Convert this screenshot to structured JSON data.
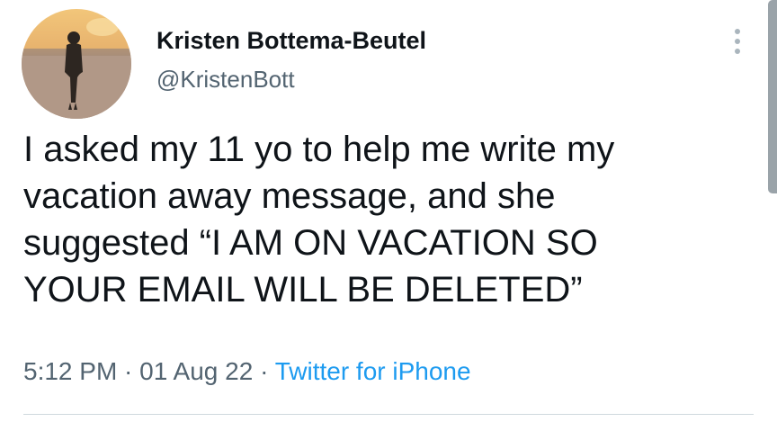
{
  "author": {
    "display_name": "Kristen Bottema-Beutel",
    "handle": "@KristenBott"
  },
  "tweet": {
    "text": "I asked my 11 yo to help me write my\nvacation away message, and she\nsuggested “I AM ON VACATION SO\nYOUR EMAIL WILL BE DELETED”"
  },
  "meta": {
    "time": "5:12 PM",
    "separator": " · ",
    "date": "01 Aug 22",
    "source": "Twitter for iPhone"
  },
  "icons": {
    "avatar": "avatar-photo",
    "more": "more-vertical-icon"
  },
  "colors": {
    "text_primary": "#0f1419",
    "text_secondary": "#536471",
    "link": "#1d9bf0",
    "divider": "#cfd9de"
  }
}
